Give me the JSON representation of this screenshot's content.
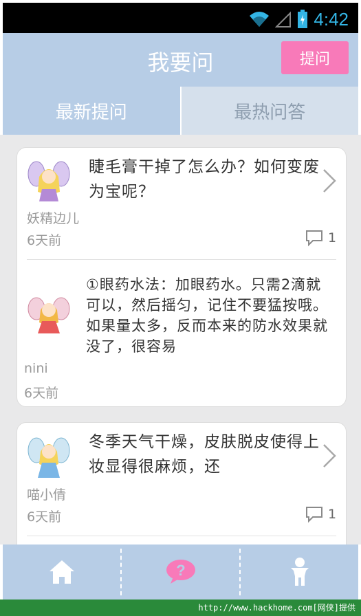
{
  "status_bar": {
    "time": "4:42"
  },
  "header": {
    "title": "我要问",
    "ask_button_label": "提问"
  },
  "tabs": [
    {
      "label": "最新提问",
      "active": true
    },
    {
      "label": "最热问答",
      "active": false
    }
  ],
  "feed": [
    {
      "question": {
        "text": "睫毛膏干掉了怎么办？如何变废为宝呢？",
        "user": "妖精边儿",
        "time": "6天前",
        "comment_count": "1"
      },
      "answer": {
        "text": "①眼药水法：加眼药水。只需2滴就可以，然后摇匀，记住不要猛按哦。如果量太多，反而本来的防水效果就没了，很容易",
        "user": "nini",
        "time": "6天前"
      }
    },
    {
      "question": {
        "text": "冬季天气干燥，皮肤脱皮使得上妆显得很麻烦，还",
        "user": "喵小倩",
        "time": "6天前",
        "comment_count": "1"
      }
    }
  ],
  "bottom_nav": [
    {
      "icon": "home-icon"
    },
    {
      "icon": "question-bubble-icon"
    },
    {
      "icon": "person-icon"
    }
  ],
  "watermark": "http://www.hackhome.com[网侠]提供",
  "colors": {
    "header_bg": "#b7cde6",
    "accent_pink": "#f87ab9",
    "status_time": "#33b5e5"
  }
}
